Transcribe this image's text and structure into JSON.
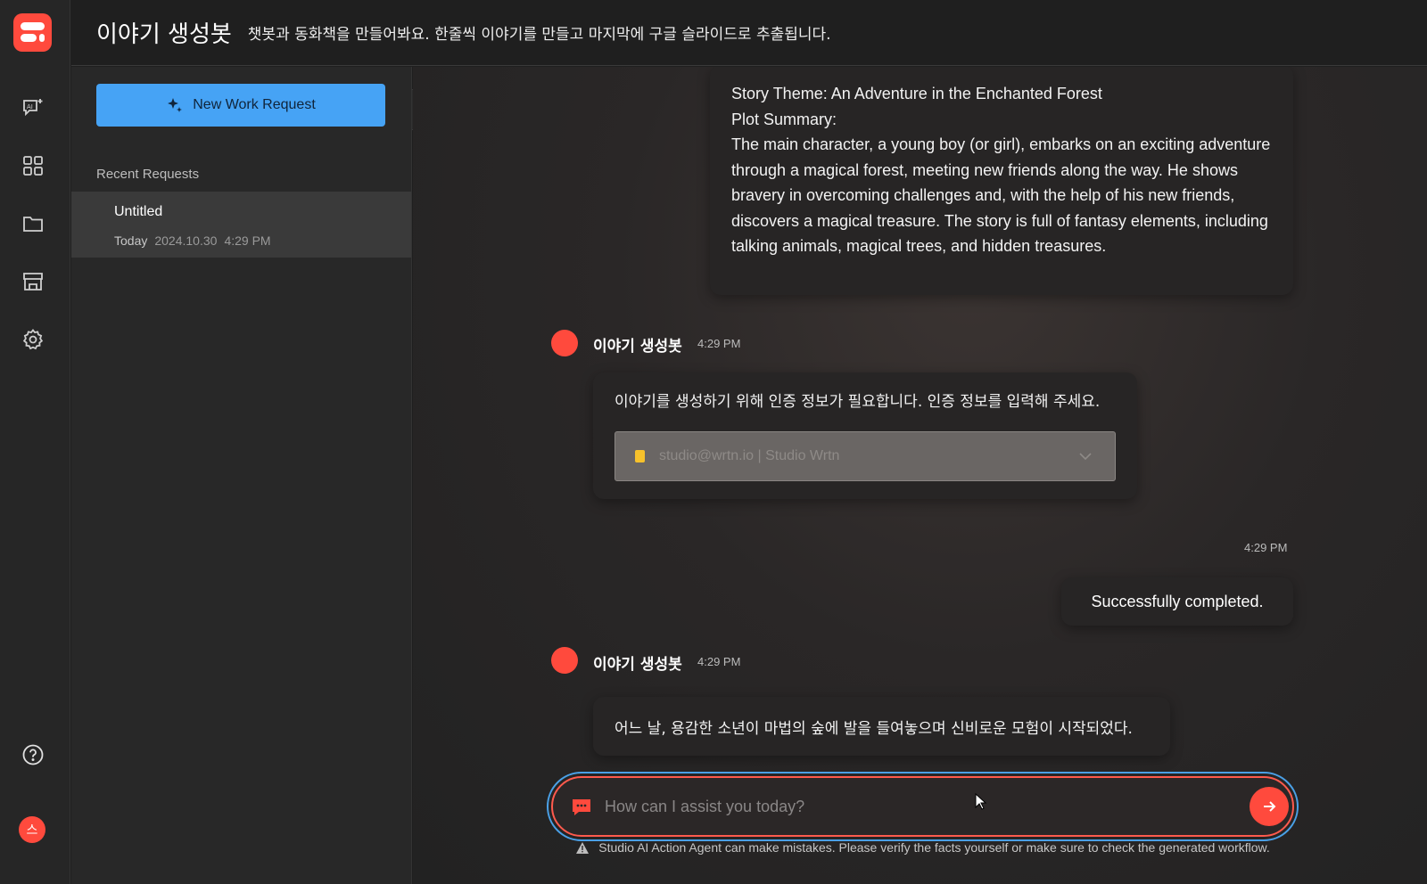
{
  "app": {
    "title": "이야기 생성봇",
    "description": "챗봇과 동화책을 만들어봐요. 한줄씩 이야기를 만들고 마지막에 구글 슬라이드로 추출됩니다."
  },
  "rail": {
    "items": [
      {
        "name": "ai-agent-icon"
      },
      {
        "name": "apps-grid-icon"
      },
      {
        "name": "folder-icon"
      },
      {
        "name": "store-icon"
      },
      {
        "name": "settings-icon"
      }
    ],
    "help_icon": "help-icon",
    "user_initial": "스"
  },
  "sidebar": {
    "new_request_label": "New Work Request",
    "recent_label": "Recent Requests",
    "recent": [
      {
        "title": "Untitled",
        "day": "Today",
        "date": "2024.10.30",
        "time": "4:29 PM"
      }
    ]
  },
  "chat": {
    "story_summary": [
      "Story Theme: An Adventure in the Enchanted Forest",
      "Plot Summary:",
      "The main character, a young boy (or girl), embarks on an exciting adventure through a magical forest, meeting new friends along the way. He shows bravery in overcoming challenges and, with the help of his new friends, discovers a magical treasure. The story is full of fantasy elements, including talking animals, magical trees, and hidden treasures."
    ],
    "messages": [
      {
        "sender": "이야기 생성봇",
        "time": "4:29 PM",
        "text": "이야기를 생성하기 위해 인증 정보가 필요합니다. 인증 정보를 입력해 주세요.",
        "select_value": "studio@wrtn.io | Studio Wrtn"
      },
      {
        "sender": "user",
        "time": "4:29 PM",
        "text": "Successfully completed."
      },
      {
        "sender": "이야기 생성봇",
        "time": "4:29 PM",
        "text": "어느 날, 용감한 소년이 마법의 숲에 발을 들여놓으며 신비로운 모험이 시작되었다."
      }
    ],
    "input_placeholder": "How can I assist you today?",
    "disclaimer": "Studio AI Action Agent can make mistakes. Please verify the facts yourself or make sure to check the generated workflow."
  },
  "colors": {
    "accent_red": "#ff4a3d",
    "accent_blue": "#46a3f5",
    "background": "#1f1f1f"
  }
}
